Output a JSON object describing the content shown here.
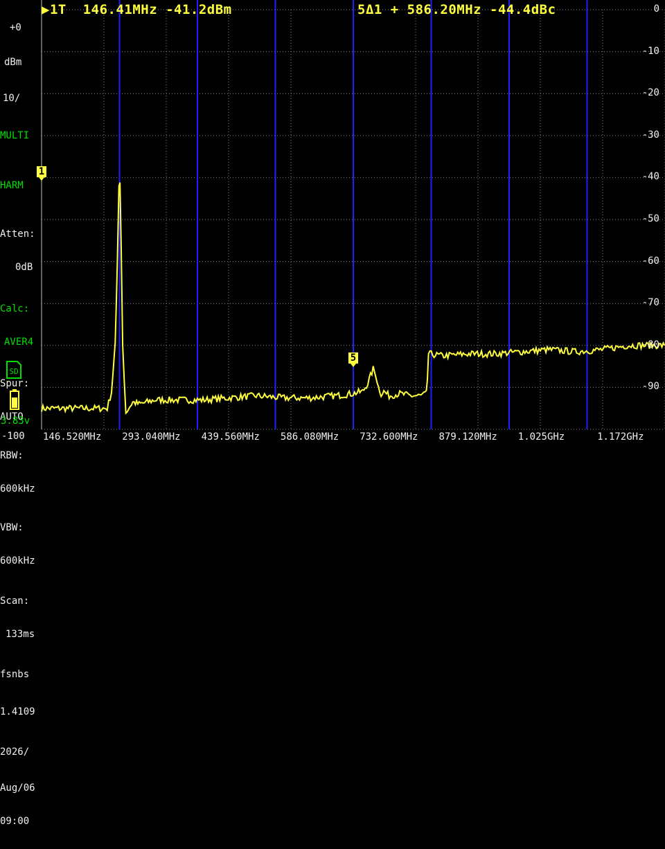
{
  "header": {
    "marker1": "▶1T  146.41MHz -41.2dBm",
    "delta": "5Δ1 + 586.20MHz -44.4dBc"
  },
  "sidebar": {
    "ref_level": "+0",
    "unit": "dBm",
    "scale": "10/",
    "trace_mode": "MULTI",
    "measure": "HARM",
    "atten_label": "Atten:",
    "atten_value": "0dB",
    "calc_label": "Calc:",
    "calc_value": "AVER4",
    "spur_label": "Spur:",
    "spur_value": "AUTO",
    "rbw_label": "RBW:",
    "rbw_value": "600kHz",
    "vbw_label": "VBW:",
    "vbw_value": "600kHz",
    "scan_label": "Scan:",
    "scan_value": "133ms",
    "fsnbs_label": "fsnbs",
    "fsnbs_value": "1.4109",
    "date": "2026/",
    "date2": "Aug/06",
    "time": "09:00",
    "sd_label": "SD",
    "voltage": "3.83v",
    "bottom_ref": "-100"
  },
  "y_axis_labels": [
    "0",
    "-10",
    "-20",
    "-30",
    "-40",
    "-50",
    "-60",
    "-70",
    "-80",
    "-90"
  ],
  "x_axis_labels": [
    "146.520MHz",
    "293.040MHz",
    "439.560MHz",
    "586.080MHz",
    "732.600MHz",
    "879.120MHz",
    "1.025GHz",
    "1.172GHz"
  ],
  "markers": [
    {
      "label": "1",
      "freq_mhz": 146.41,
      "level_dbm": -41.2
    },
    {
      "label": "5",
      "freq_mhz": 732.61,
      "level_dbm": -85.6
    }
  ],
  "colors": {
    "trace": "#ffff40",
    "grid": "#8a8a8a",
    "harmonic_lines": "#2020ff",
    "label_green": "#00e000"
  },
  "chart_data": {
    "type": "line",
    "x_start_mhz": 146.52,
    "x_end_mhz": 1318.68,
    "ylim": [
      -100,
      0
    ],
    "harmonic_freqs_mhz": [
      293.04,
      439.56,
      586.08,
      732.6,
      879.12,
      1025.64,
      1172.16,
      1318.68
    ],
    "series": [
      {
        "x": [
          146.5,
          220,
          270,
          278,
          285,
          289,
          292,
          294,
          296,
          299,
          305,
          318,
          330,
          360,
          400,
          450,
          500,
          550,
          600,
          650,
          700,
          730,
          750,
          760,
          770,
          775,
          780,
          785,
          790,
          800,
          820,
          840,
          860,
          870,
          872,
          874,
          900,
          950,
          1000,
          1050,
          1100,
          1150,
          1200,
          1250,
          1300,
          1318
        ],
        "y": [
          -95,
          -95,
          -95,
          -91,
          -80,
          -60,
          -42,
          -41.2,
          -55,
          -80,
          -96,
          -93.5,
          -94,
          -93,
          -93,
          -93,
          -92.5,
          -92,
          -92.5,
          -92.5,
          -92,
          -91.5,
          -91,
          -89,
          -85.6,
          -87,
          -90,
          -91.5,
          -91,
          -92,
          -91.5,
          -92,
          -92,
          -91.5,
          -88,
          -82,
          -82.5,
          -82,
          -82,
          -81.5,
          -81,
          -81.5,
          -81,
          -80,
          -80,
          -80
        ]
      }
    ]
  }
}
